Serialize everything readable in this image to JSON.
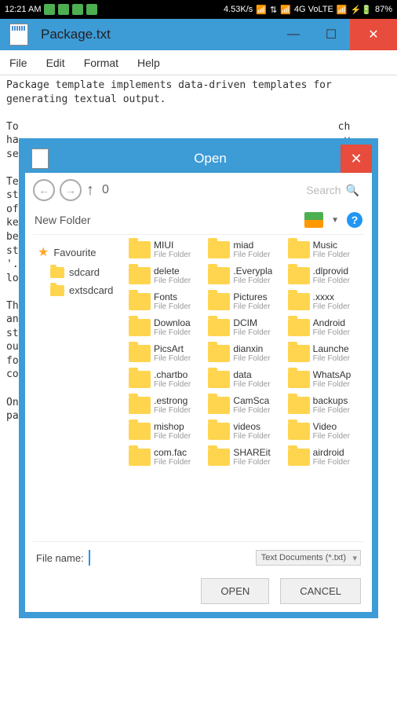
{
  "status": {
    "time": "12:21 AM",
    "speed": "4.53K/s",
    "network": "4G VoLTE",
    "battery": "87%"
  },
  "window": {
    "title": "Package.txt"
  },
  "menu": {
    "file": "File",
    "edit": "Edit",
    "format": "Format",
    "help": "Help"
  },
  "content": {
    "text": "Package template implements data-driven templates for generating textual output.\n\nTo                                                    ch\nha                                                     y\nse\n\nTe\nst                                                     s\nof                                                      a\nke\nbe\nst\n'.\nlo\n\nTh\nan\nst\nou                                                    ot\nfo                                                    in\nco\n\nOn\npa"
  },
  "dialog": {
    "title": "Open",
    "path": "0",
    "search_placeholder": "Search",
    "new_folder": "New Folder",
    "favourite": "Favourite",
    "sidebar": [
      {
        "name": "sdcard"
      },
      {
        "name": "extsdcard"
      }
    ],
    "folders": [
      {
        "name": "MIUI",
        "type": "File Folder"
      },
      {
        "name": "miad",
        "type": "File Folder"
      },
      {
        "name": "Music",
        "type": "File Folder"
      },
      {
        "name": "delete",
        "type": "File Folder"
      },
      {
        "name": ".Everypla",
        "type": "File Folder"
      },
      {
        "name": ".dlprovid",
        "type": "File Folder"
      },
      {
        "name": "Fonts",
        "type": "File Folder"
      },
      {
        "name": "Pictures",
        "type": "File Folder"
      },
      {
        "name": ".xxxx",
        "type": "File Folder"
      },
      {
        "name": "Downloa",
        "type": "File Folder"
      },
      {
        "name": "DCIM",
        "type": "File Folder"
      },
      {
        "name": "Android",
        "type": "File Folder"
      },
      {
        "name": "PicsArt",
        "type": "File Folder"
      },
      {
        "name": "dianxin",
        "type": "File Folder"
      },
      {
        "name": "Launche",
        "type": "File Folder"
      },
      {
        "name": ".chartbo",
        "type": "File Folder"
      },
      {
        "name": "data",
        "type": "File Folder"
      },
      {
        "name": "WhatsAp",
        "type": "File Folder"
      },
      {
        "name": ".estrong",
        "type": "File Folder"
      },
      {
        "name": "CamSca",
        "type": "File Folder"
      },
      {
        "name": "backups",
        "type": "File Folder"
      },
      {
        "name": "mishop",
        "type": "File Folder"
      },
      {
        "name": "videos",
        "type": "File Folder"
      },
      {
        "name": "Video",
        "type": "File Folder"
      },
      {
        "name": "com.fac",
        "type": "File Folder"
      },
      {
        "name": "SHAREit",
        "type": "File Folder"
      },
      {
        "name": "airdroid",
        "type": "File Folder"
      }
    ],
    "filename_label": "File name:",
    "filetype": "Text Documents (*.txt)",
    "open_btn": "OPEN",
    "cancel_btn": "CANCEL"
  }
}
